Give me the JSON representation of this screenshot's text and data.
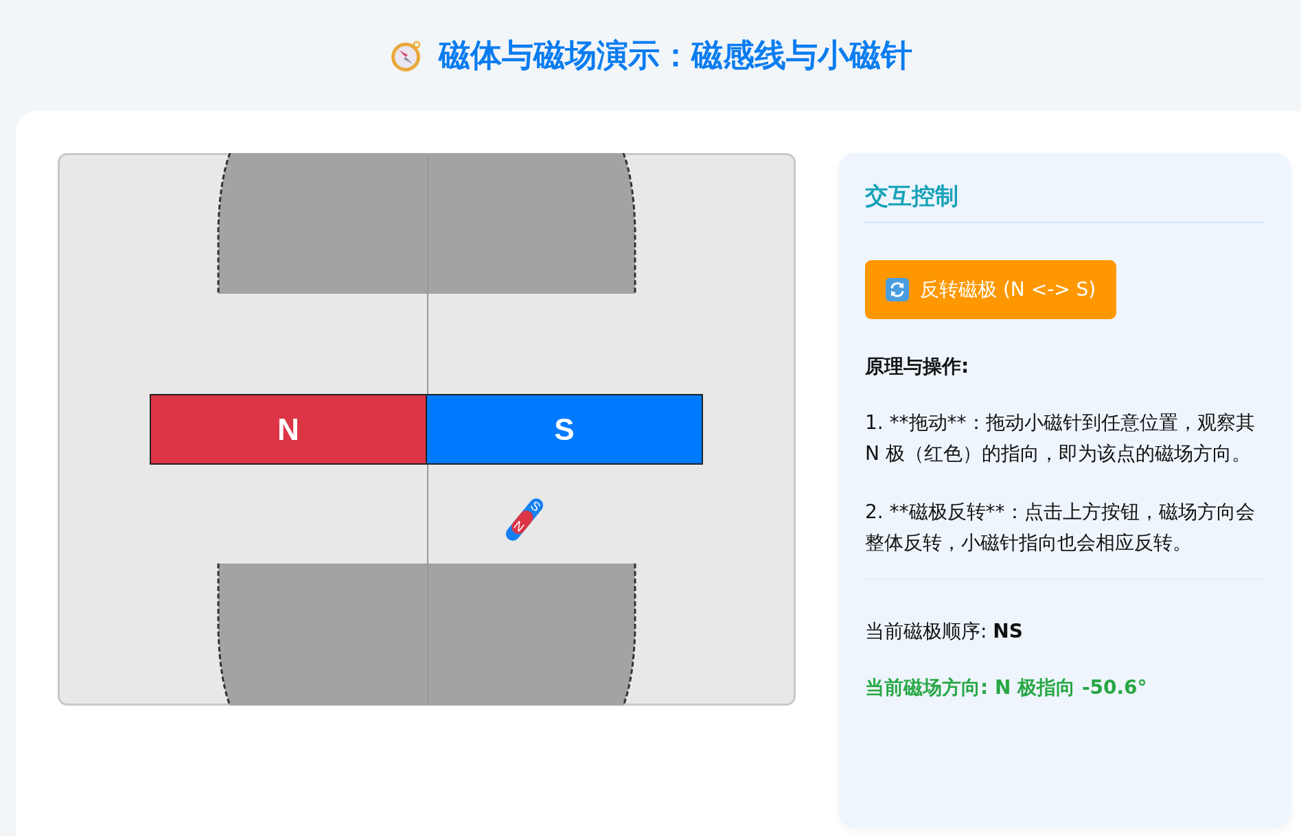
{
  "title": "磁体与磁场演示：磁感线与小磁针",
  "magnet": {
    "poles": [
      {
        "label": "N",
        "color": "#dc3545"
      },
      {
        "label": "S",
        "color": "#007bff"
      }
    ]
  },
  "needle": {
    "north_label": "N",
    "south_label": "S"
  },
  "controls": {
    "heading": "交互控制",
    "flip_button": "反转磁极 (N <-> S)",
    "principles_heading": "原理与操作:",
    "paragraphs": [
      "1. **拖动**：拖动小磁针到任意位置，观察其 N 极（红色）的指向，即为该点的磁场方向。",
      "2. **磁极反转**：点击上方按钮，磁场方向会整体反转，小磁针指向也会相应反转。"
    ],
    "pole_order": "当前磁极顺序: **NS**",
    "field_direction": "当前磁场方向: N 极指向 -50.6°"
  }
}
